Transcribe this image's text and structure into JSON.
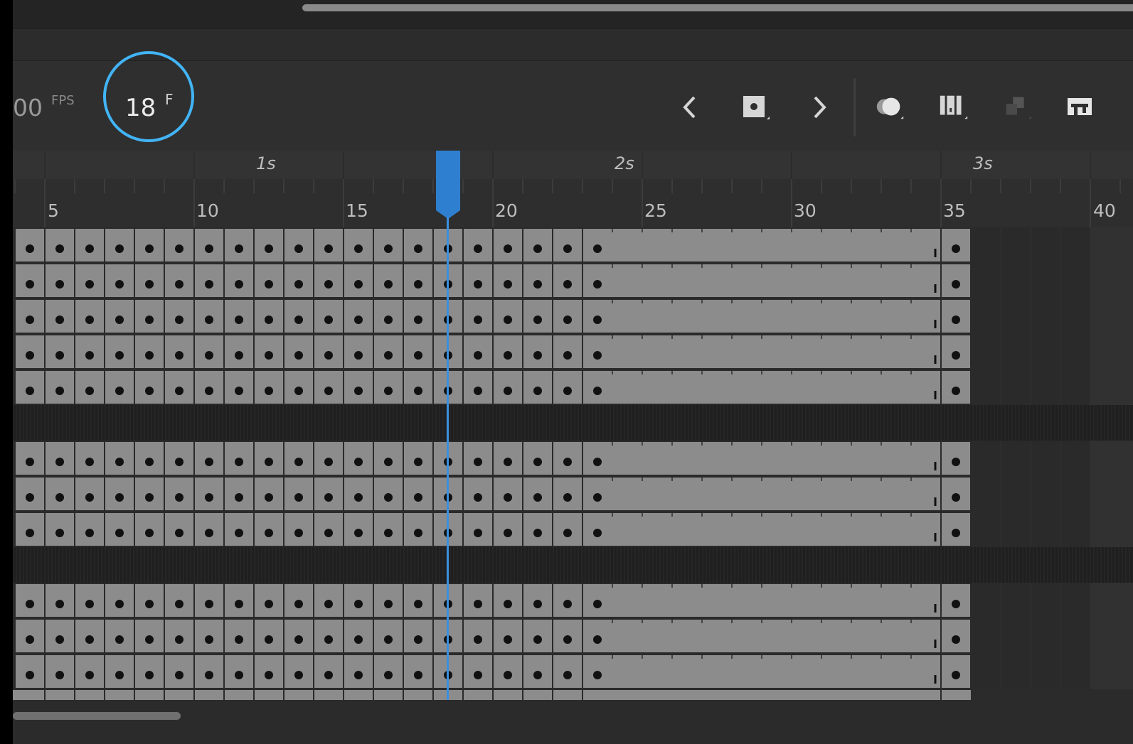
{
  "timeline": {
    "fps_value": "00",
    "fps_unit": "FPS",
    "current_frame": "18",
    "current_frame_unit": "F",
    "seconds_labels": [
      "1s",
      "2s",
      "3s"
    ],
    "frame_labels": [
      "5",
      "10",
      "15",
      "20",
      "25",
      "30",
      "35",
      "40"
    ],
    "playhead_frame": 18,
    "accent_color": "#42b4f5",
    "playhead_color": "#2f7fd0",
    "layers": [
      {
        "type": "layer",
        "keyframes_until": 22,
        "tween_end": 35
      },
      {
        "type": "layer",
        "keyframes_until": 22,
        "tween_end": 35
      },
      {
        "type": "layer",
        "keyframes_until": 22,
        "tween_end": 35
      },
      {
        "type": "layer",
        "keyframes_until": 22,
        "tween_end": 35
      },
      {
        "type": "layer",
        "keyframes_until": 22,
        "tween_end": 35
      },
      {
        "type": "folder"
      },
      {
        "type": "layer",
        "keyframes_until": 22,
        "tween_end": 35
      },
      {
        "type": "layer",
        "keyframes_until": 22,
        "tween_end": 35
      },
      {
        "type": "layer",
        "keyframes_until": 22,
        "tween_end": 35
      },
      {
        "type": "folder"
      },
      {
        "type": "layer",
        "keyframes_until": 22,
        "tween_end": 35
      },
      {
        "type": "layer",
        "keyframes_until": 22,
        "tween_end": 35
      },
      {
        "type": "layer",
        "keyframes_until": 22,
        "tween_end": 35
      }
    ]
  },
  "toolbar_icons": [
    "previous-keyframe-icon",
    "insert-keyframe-icon",
    "next-keyframe-icon",
    "onion-skin-icon",
    "edit-multiple-frames-icon",
    "paste-frames-icon",
    "loop-icon"
  ]
}
